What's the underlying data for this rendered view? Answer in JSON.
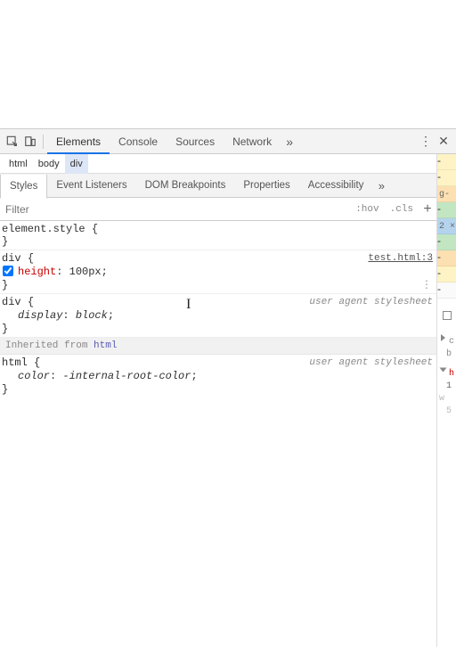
{
  "toolbar": {
    "tabs": [
      "Elements",
      "Console",
      "Sources",
      "Network"
    ],
    "active": 0
  },
  "breadcrumb": [
    "html",
    "body",
    "div"
  ],
  "breadcrumb_selected": 2,
  "subtabs": [
    "Styles",
    "Event Listeners",
    "DOM Breakpoints",
    "Properties",
    "Accessibility"
  ],
  "subtab_active": 0,
  "filter": {
    "placeholder": "Filter",
    "hov": ":hov",
    "cls": ".cls"
  },
  "rules": {
    "r0": {
      "selector": "element.style",
      "open": "{",
      "close": "}"
    },
    "r1": {
      "selector": "div",
      "open": "{",
      "source": "test.html:3",
      "decl_prop": "height",
      "decl_val": "100px",
      "close": "}"
    },
    "r2": {
      "selector": "div",
      "open": "{",
      "ua": "user agent stylesheet",
      "decl_prop": "display",
      "decl_val": "block",
      "close": "}"
    },
    "inherited_label": "Inherited from ",
    "inherited_from": "html",
    "r3": {
      "selector": "html",
      "open": "{",
      "ua": "user agent stylesheet",
      "decl_prop": "color",
      "decl_val": "-internal-root-color",
      "close": "}"
    }
  },
  "right": {
    "snips": [
      "g-",
      "2 ×",
      "c",
      "b",
      "h",
      "1",
      "w",
      "5"
    ]
  }
}
